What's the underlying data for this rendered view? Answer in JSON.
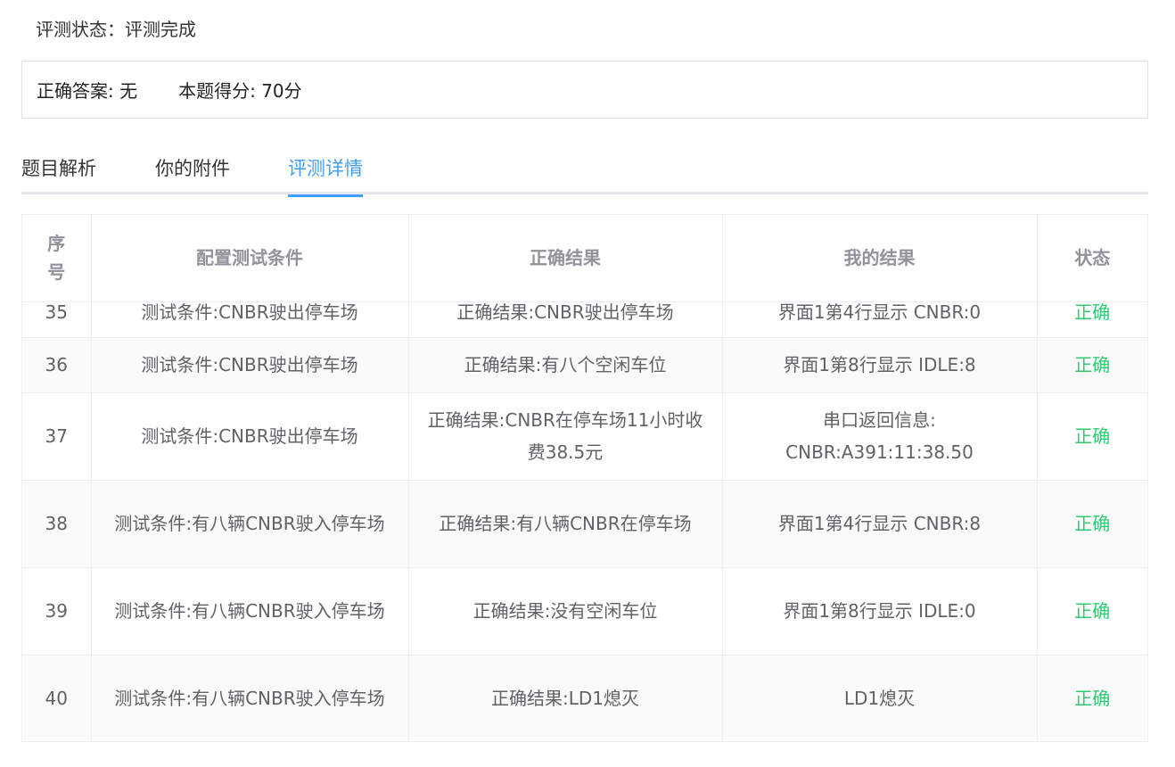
{
  "header": {
    "status_text": "评测状态：评测完成"
  },
  "answer_box": {
    "correct_answer": "正确答案:  无",
    "score": "本题得分: 70分"
  },
  "tabs": [
    {
      "label": "题目解析",
      "active": false
    },
    {
      "label": "你的附件",
      "active": false
    },
    {
      "label": "评测详情",
      "active": true
    }
  ],
  "table": {
    "columns": [
      "序号",
      "配置测试条件",
      "正确结果",
      "我的结果",
      "状态"
    ],
    "rows": [
      {
        "seq": "35",
        "condition": "测试条件:CNBR驶出停车场",
        "expected": "正确结果:CNBR驶出停车场",
        "actual": "界面1第4行显示 CNBR:0",
        "status": "正确"
      },
      {
        "seq": "36",
        "condition": "测试条件:CNBR驶出停车场",
        "expected": "正确结果:有八个空闲车位",
        "actual": "界面1第8行显示 IDLE:8",
        "status": "正确"
      },
      {
        "seq": "37",
        "condition": "测试条件:CNBR驶出停车场",
        "expected": "正确结果:CNBR在停车场11小时收费38.5元",
        "actual": "串口返回信息: CNBR:A391:11:38.50",
        "status": "正确"
      },
      {
        "seq": "38",
        "condition": "测试条件:有八辆CNBR驶入停车场",
        "expected": "正确结果:有八辆CNBR在停车场",
        "actual": "界面1第4行显示 CNBR:8",
        "status": "正确"
      },
      {
        "seq": "39",
        "condition": "测试条件:有八辆CNBR驶入停车场",
        "expected": "正确结果:没有空闲车位",
        "actual": "界面1第8行显示 IDLE:0",
        "status": "正确"
      },
      {
        "seq": "40",
        "condition": "测试条件:有八辆CNBR驶入停车场",
        "expected": "正确结果:LD1熄灭",
        "actual": "LD1熄灭",
        "status": "正确"
      }
    ]
  },
  "colors": {
    "accent": "#409eff",
    "success": "#2ecc71",
    "header_text": "#909399",
    "cell_text": "#606266",
    "border": "#ebeef5"
  }
}
